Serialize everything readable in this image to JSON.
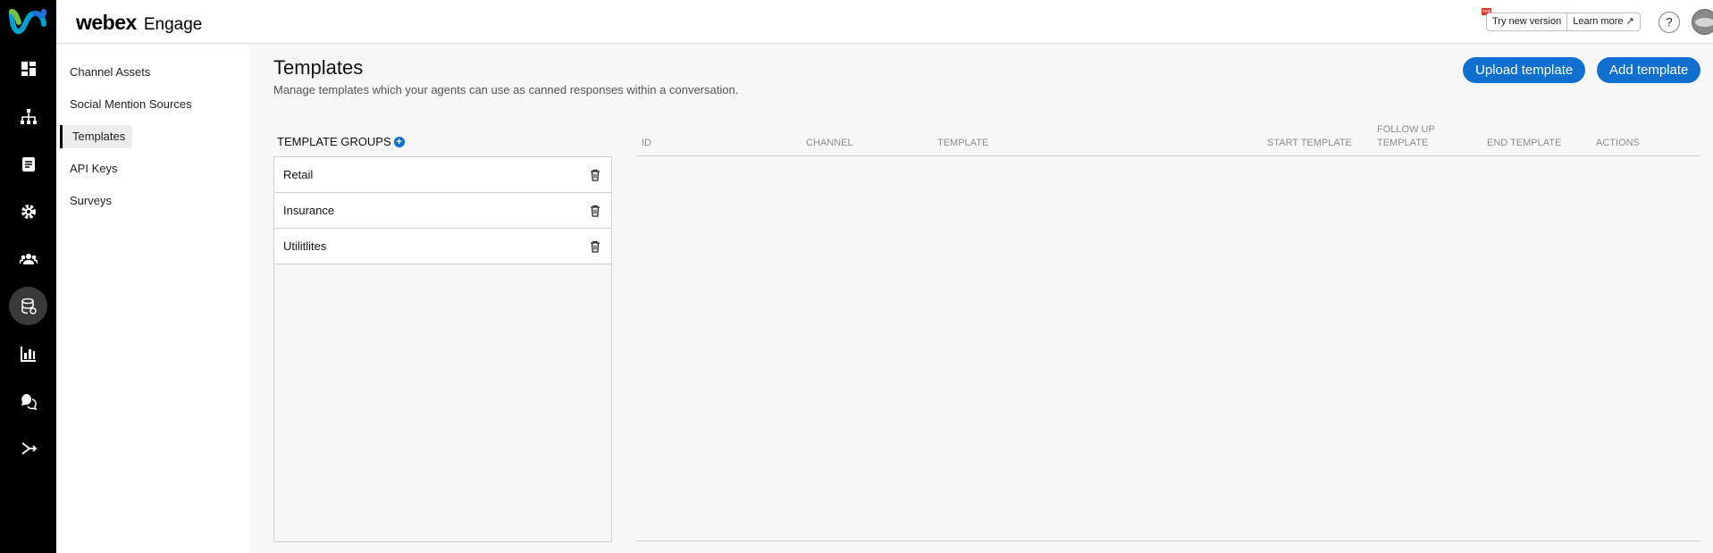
{
  "brand": {
    "name": "webex",
    "product": "Engage"
  },
  "header": {
    "try_new_version": "Try new version",
    "learn_more": "Learn more",
    "help": "?"
  },
  "subnav": {
    "items": [
      {
        "label": "Channel Assets"
      },
      {
        "label": "Social Mention Sources"
      },
      {
        "label": "Templates"
      },
      {
        "label": "API Keys"
      },
      {
        "label": "Surveys"
      }
    ],
    "active": "Templates"
  },
  "page": {
    "title": "Templates",
    "description": "Manage templates which your agents can use as canned responses within a conversation.",
    "upload_label": "Upload template",
    "add_label": "Add template"
  },
  "groups": {
    "title": "TEMPLATE GROUPS",
    "items": [
      {
        "label": "Retail"
      },
      {
        "label": "Insurance"
      },
      {
        "label": "Utilitlites"
      }
    ]
  },
  "table": {
    "columns": [
      "ID",
      "CHANNEL",
      "TEMPLATE",
      "START TEMPLATE",
      "FOLLOW UP TEMPLATE",
      "END TEMPLATE",
      "ACTIONS"
    ],
    "rows": []
  },
  "colors": {
    "accent": "#1170cf",
    "rail": "#000000"
  }
}
